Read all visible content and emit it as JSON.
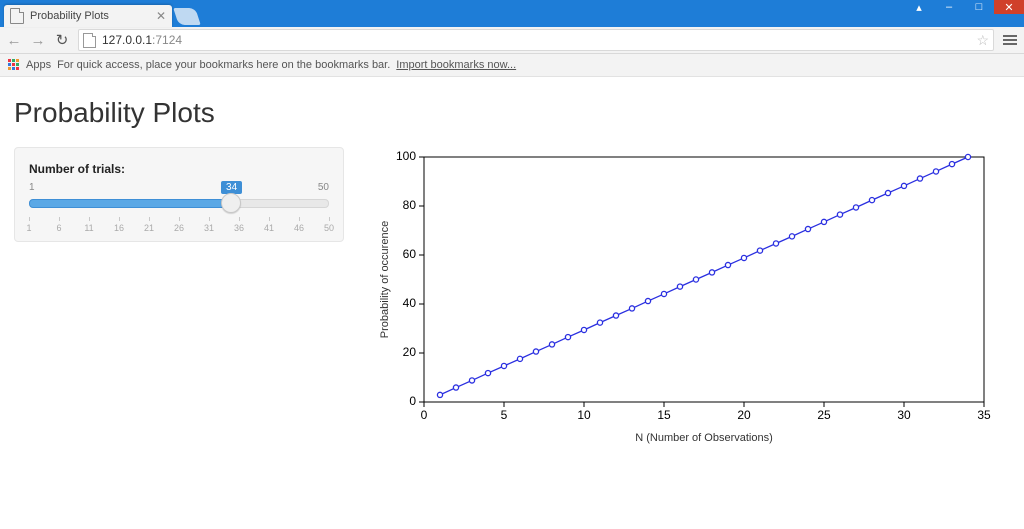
{
  "browser": {
    "tab_title": "Probability Plots",
    "url_host": "127.0.0.1",
    "url_port": ":7124",
    "apps_label": "Apps",
    "bookmark_hint_a": "For quick access, place your bookmarks here on the bookmarks bar.",
    "bookmark_hint_link": "Import bookmarks now...",
    "win_user": "▴",
    "win_min": "–",
    "win_max": "□",
    "win_close": "✕"
  },
  "page": {
    "title": "Probability Plots",
    "slider": {
      "label": "Number of trials:",
      "min": 1,
      "max": 50,
      "value": 34,
      "ticks": [
        1,
        6,
        11,
        16,
        21,
        26,
        31,
        36,
        41,
        46,
        50
      ]
    }
  },
  "chart_data": {
    "type": "line",
    "title": "",
    "xlabel": "N (Number of Observations)",
    "ylabel": "Probability of occurence",
    "xlim": [
      0,
      35
    ],
    "ylim": [
      0,
      100
    ],
    "xticks": [
      0,
      5,
      10,
      15,
      20,
      25,
      30,
      35
    ],
    "yticks": [
      0,
      20,
      40,
      60,
      80,
      100
    ],
    "x": [
      1,
      2,
      3,
      4,
      5,
      6,
      7,
      8,
      9,
      10,
      11,
      12,
      13,
      14,
      15,
      16,
      17,
      18,
      19,
      20,
      21,
      22,
      23,
      24,
      25,
      26,
      27,
      28,
      29,
      30,
      31,
      32,
      33,
      34
    ],
    "values": [
      2.9,
      5.9,
      8.8,
      11.8,
      14.7,
      17.6,
      20.6,
      23.5,
      26.5,
      29.4,
      32.4,
      35.3,
      38.2,
      41.2,
      44.1,
      47.1,
      50.0,
      52.9,
      55.9,
      58.8,
      61.8,
      64.7,
      67.6,
      70.6,
      73.5,
      76.5,
      79.4,
      82.4,
      85.3,
      88.2,
      91.2,
      94.1,
      97.1,
      100.0
    ]
  }
}
